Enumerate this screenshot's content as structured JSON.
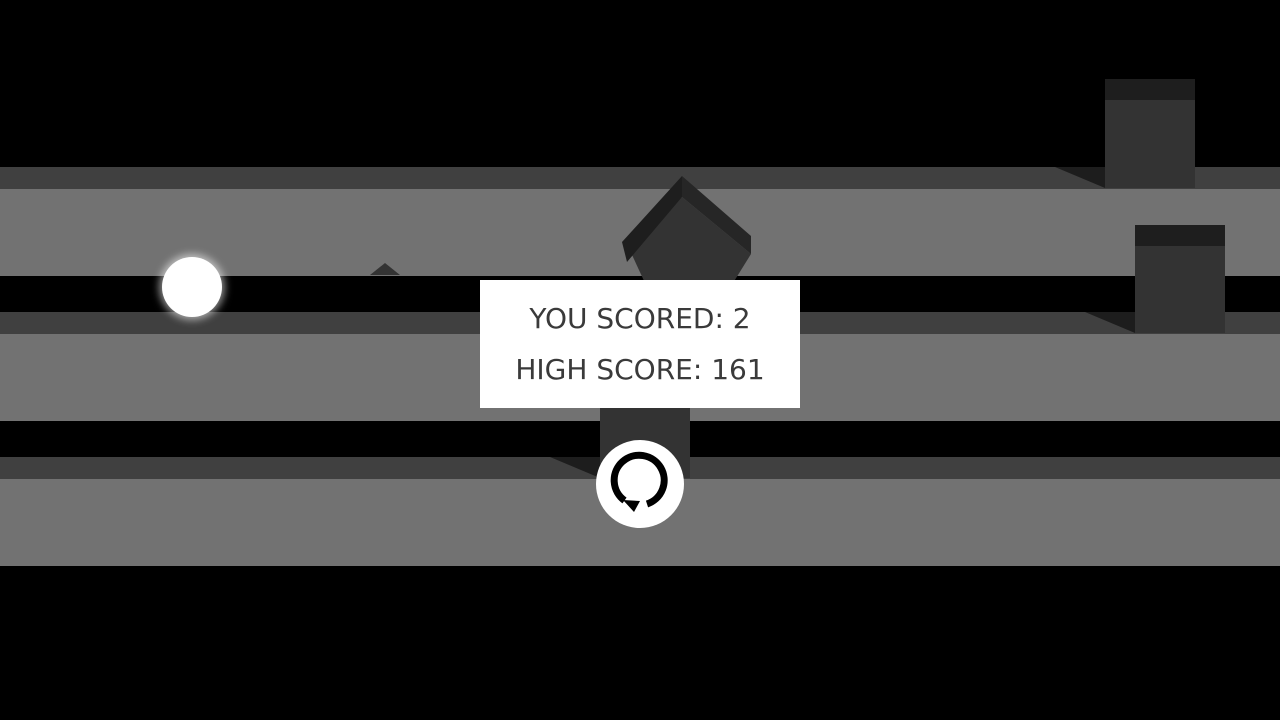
{
  "game_over": {
    "score_label": "YOU SCORED:",
    "score_value": "2",
    "high_score_label": "HIGH SCORE:",
    "high_score_value": "161"
  },
  "restart": {
    "icon": "restart-icon"
  },
  "colors": {
    "background": "#000000",
    "lane_surface": "#727272",
    "lane_edge": "#404040",
    "block": "#333333",
    "block_cap": "#1e1e1e",
    "ball": "#ffffff",
    "panel": "#ffffff",
    "panel_text": "#3a3a3a"
  }
}
